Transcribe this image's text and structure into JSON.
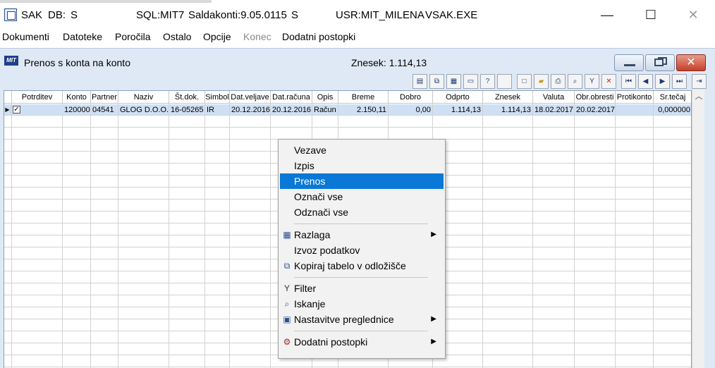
{
  "titlebar": {
    "app": "SAK",
    "db": "DB:",
    "db_suffix": "S",
    "sql": "SQL:MIT7",
    "saldakonti": "Saldakonti:9.05.0115",
    "sep": "S",
    "usr": "USR:MIT_MILENA",
    "exe": "VSAK.EXE",
    "minimize": "—",
    "maximize": "☐",
    "close": "✕"
  },
  "menubar": {
    "items": [
      "Dokumenti",
      "Datoteke",
      "Poročila",
      "Ostalo",
      "Opcije",
      "Konec",
      "Dodatni postopki"
    ]
  },
  "child": {
    "logo": "MIT",
    "title": "Prenos s konta na konto",
    "amount_label": "Znesek: 1.114,13",
    "close_symbol": "✕"
  },
  "grid": {
    "columns": [
      "Potrditev",
      "Konto",
      "Partner",
      "Naziv",
      "Št.dok.",
      "Simbol",
      "Dat.veljave",
      "Dat.računa",
      "Opis",
      "Breme",
      "Dobro",
      "Odprto",
      "Znesek",
      "Valuta",
      "Obr.obresti",
      "Protikonto",
      "Sr.tečaj"
    ],
    "rows": [
      {
        "checked": "✓",
        "konto": "120000",
        "partner": "04541",
        "naziv": "GLOG D.O.O.",
        "stdok": "16-05265",
        "simbol": "IR",
        "datveljave": "20.12.2016",
        "datracuna": "20.12.2016",
        "opis": "Račun",
        "breme": "2.150,11",
        "dobro": "0,00",
        "odprto": "1.114,13",
        "znesek": "1.114,13",
        "valuta": "18.02.2017",
        "obrobresti": "20.02.2017",
        "protikonto": "",
        "srtecaj": "0,000000"
      }
    ]
  },
  "context_menu": {
    "items": [
      {
        "label": "Vezave"
      },
      {
        "label": "Izpis"
      },
      {
        "label": "Prenos"
      },
      {
        "label": "Označi vse"
      },
      {
        "label": "Odznači vse"
      },
      {
        "label": "Razlaga"
      },
      {
        "label": "Izvoz podatkov"
      },
      {
        "label": "Kopiraj tabelo v odložišče"
      },
      {
        "label": "Filter"
      },
      {
        "label": "Iskanje"
      },
      {
        "label": "Nastavitve preglednice"
      },
      {
        "label": "Dodatni postopki"
      }
    ]
  },
  "colors": {
    "highlight": "#0a78d7",
    "child_bg": "#dfe9f5",
    "selected_row": "#cfe0f4"
  }
}
